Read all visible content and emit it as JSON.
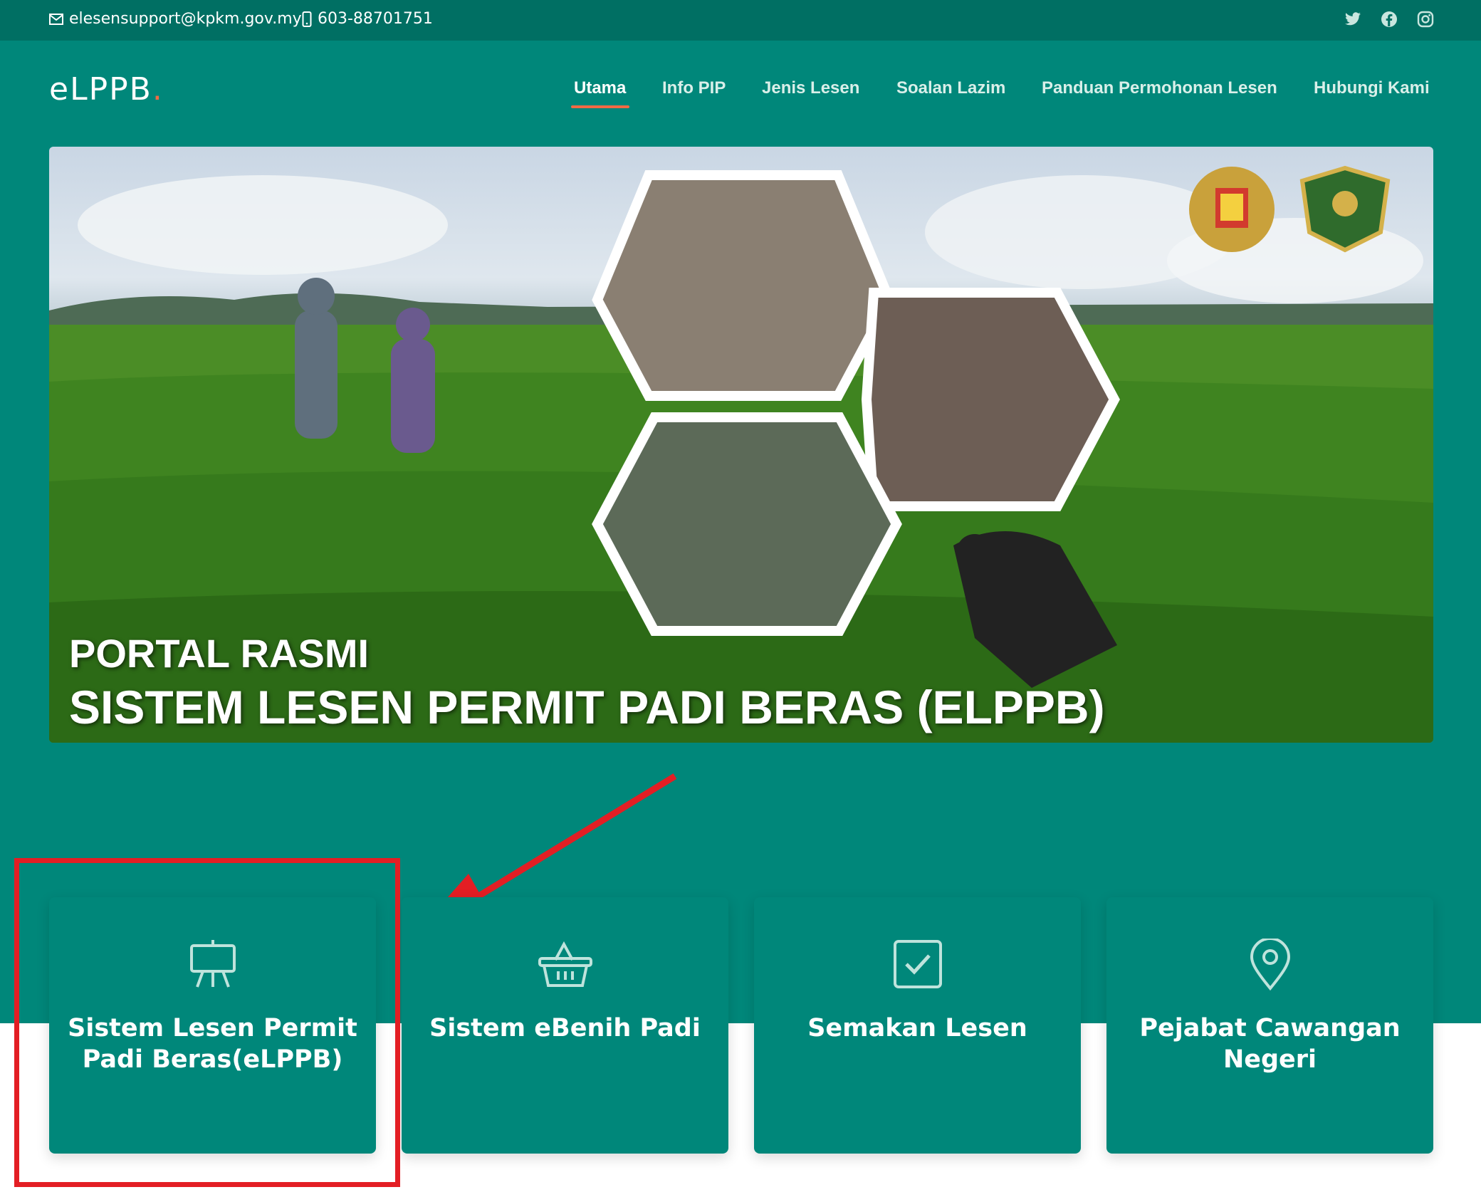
{
  "topbar": {
    "email": "elesensupport@kpkm.gov.my",
    "phone": "603-88701751",
    "social_icons": [
      "twitter-icon",
      "facebook-icon",
      "instagram-icon"
    ]
  },
  "header": {
    "logo_text": "eLPPB",
    "logo_dot": ".",
    "nav": [
      {
        "label": "Utama",
        "active": true
      },
      {
        "label": "Info PIP",
        "active": false
      },
      {
        "label": "Jenis Lesen",
        "active": false
      },
      {
        "label": "Soalan Lazim",
        "active": false
      },
      {
        "label": "Panduan Permohonan Lesen",
        "active": false
      },
      {
        "label": "Hubungi Kami",
        "active": false
      }
    ]
  },
  "hero": {
    "title_line1": "PORTAL RASMI",
    "title_line2": "SISTEM LESEN PERMIT PADI BERAS (ELPPB)"
  },
  "cards": [
    {
      "icon": "easel-icon",
      "label": "Sistem Lesen Permit Padi Beras(eLPPB)"
    },
    {
      "icon": "basket-icon",
      "label": "Sistem eBenih Padi"
    },
    {
      "icon": "checkbox-icon",
      "label": "Semakan Lesen"
    },
    {
      "icon": "location-pin-icon",
      "label": "Pejabat Cawangan Negeri"
    }
  ],
  "colors": {
    "primary_teal": "#00877a",
    "topbar_teal": "#006f63",
    "accent_orange": "#f26a44",
    "annotation_red": "#e31e24"
  }
}
